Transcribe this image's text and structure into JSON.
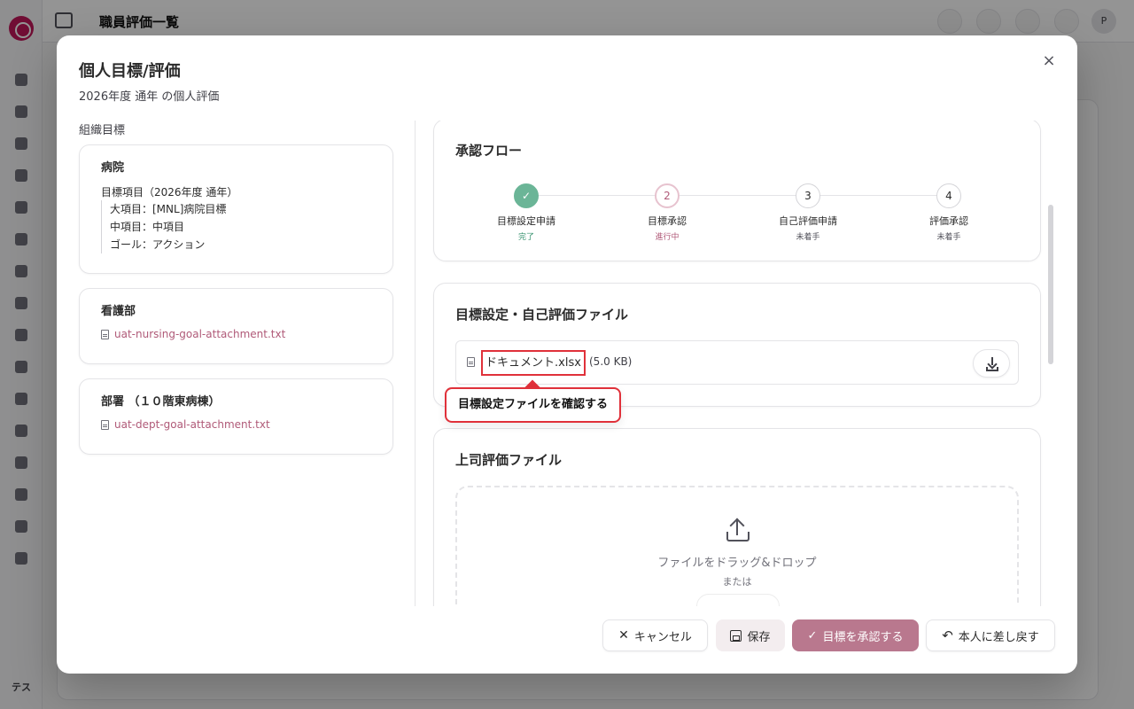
{
  "app": {
    "page_title": "職員評価一覧",
    "user_initials_header": "P",
    "user_initials_sidebar": "テス"
  },
  "dialog": {
    "title": "個人目標/評価",
    "subtitle": "2026年度 通年 の個人評価",
    "close_symbol": "×"
  },
  "org_goals": {
    "label": "組織目標",
    "hospital": {
      "name": "病院",
      "goal_header": "目標項目（2026年度 通年）",
      "items": [
        "大項目：[MNL]病院目標",
        "中項目：中項目",
        "ゴール：アクション"
      ]
    },
    "nursing": {
      "name": "看護部",
      "attachment": "uat-nursing-goal-attachment.txt"
    },
    "department": {
      "name": "部署 （１０階東病棟）",
      "attachment": "uat-dept-goal-attachment.txt"
    }
  },
  "approval_flow": {
    "title": "承認フロー",
    "steps": [
      {
        "symbol": "✓",
        "label": "目標設定申請",
        "status": "完了"
      },
      {
        "symbol": "2",
        "label": "目標承認",
        "status": "進行中"
      },
      {
        "symbol": "3",
        "label": "自己評価申請",
        "status": "未着手"
      },
      {
        "symbol": "4",
        "label": "評価承認",
        "status": "未着手"
      }
    ]
  },
  "goal_file": {
    "title": "目標設定・自己評価ファイル",
    "file_name": "ドキュメント.xlsx",
    "file_size": "(5.0 KB)",
    "tooltip": "目標設定ファイルを確認する"
  },
  "supervisor_file": {
    "title": "上司評価ファイル",
    "drop_text": "ファイルをドラッグ&ドロップ",
    "or_text": "または"
  },
  "footer": {
    "cancel": "キャンセル",
    "save": "保存",
    "approve": "目標を承認する",
    "return": "本人に差し戻す"
  },
  "colors": {
    "accent": "#b9788e",
    "accent_text": "#b05a78",
    "done_green": "#6bb597",
    "highlight_red": "#e0313a"
  }
}
